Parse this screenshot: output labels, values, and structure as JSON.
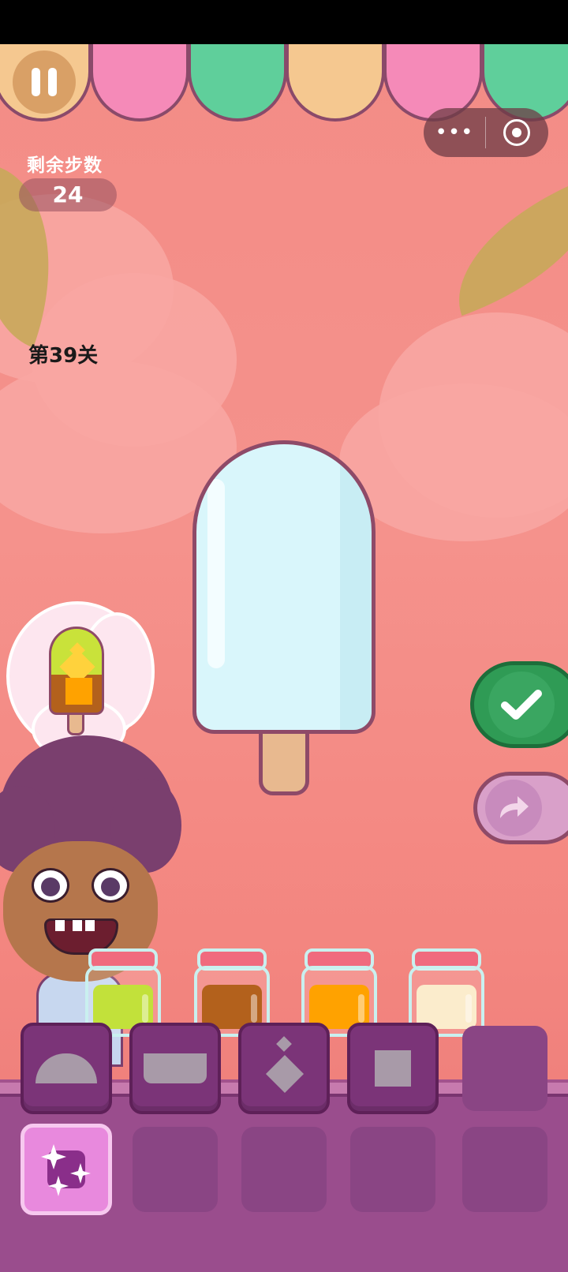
{
  "hud": {
    "steps_label": "剩余步数",
    "steps_value": "24",
    "level_label": "第39关",
    "menu_dots": "•••"
  },
  "icons": {
    "pause": "pause-icon",
    "more": "more-dots-icon",
    "close_target": "target-circle-icon",
    "confirm": "checkmark-icon",
    "redo": "redo-arrow-icon",
    "sparkle": "sparkle-icon"
  },
  "popsicle": {
    "fill_color": "#d9f6fb",
    "stick_color": "#e8b98f"
  },
  "order": {
    "colors": {
      "top": "#c9e23a",
      "bottom": "#b3611c",
      "diamond": "#ffd23c",
      "square": "#ffa200"
    }
  },
  "jars": [
    {
      "name": "lime",
      "color": "#c2e13a"
    },
    {
      "name": "caramel",
      "color": "#b3611c"
    },
    {
      "name": "orange",
      "color": "#ffa200"
    },
    {
      "name": "vanilla",
      "color": "#fbeccc"
    }
  ],
  "tools": [
    {
      "name": "dome",
      "filled": true
    },
    {
      "name": "bowl",
      "filled": true
    },
    {
      "name": "diamonds",
      "filled": true
    },
    {
      "name": "square",
      "filled": true
    },
    {
      "name": "empty",
      "filled": false
    },
    {
      "name": "sparkle",
      "filled": true,
      "special": true
    },
    {
      "name": "empty",
      "filled": false
    },
    {
      "name": "empty",
      "filled": false
    },
    {
      "name": "empty",
      "filled": false
    },
    {
      "name": "empty",
      "filled": false
    }
  ],
  "awning_colors": [
    "#f5c890",
    "#f58ab8",
    "#5fcf9b",
    "#f5c890",
    "#f58ab8",
    "#5fcf9b"
  ]
}
